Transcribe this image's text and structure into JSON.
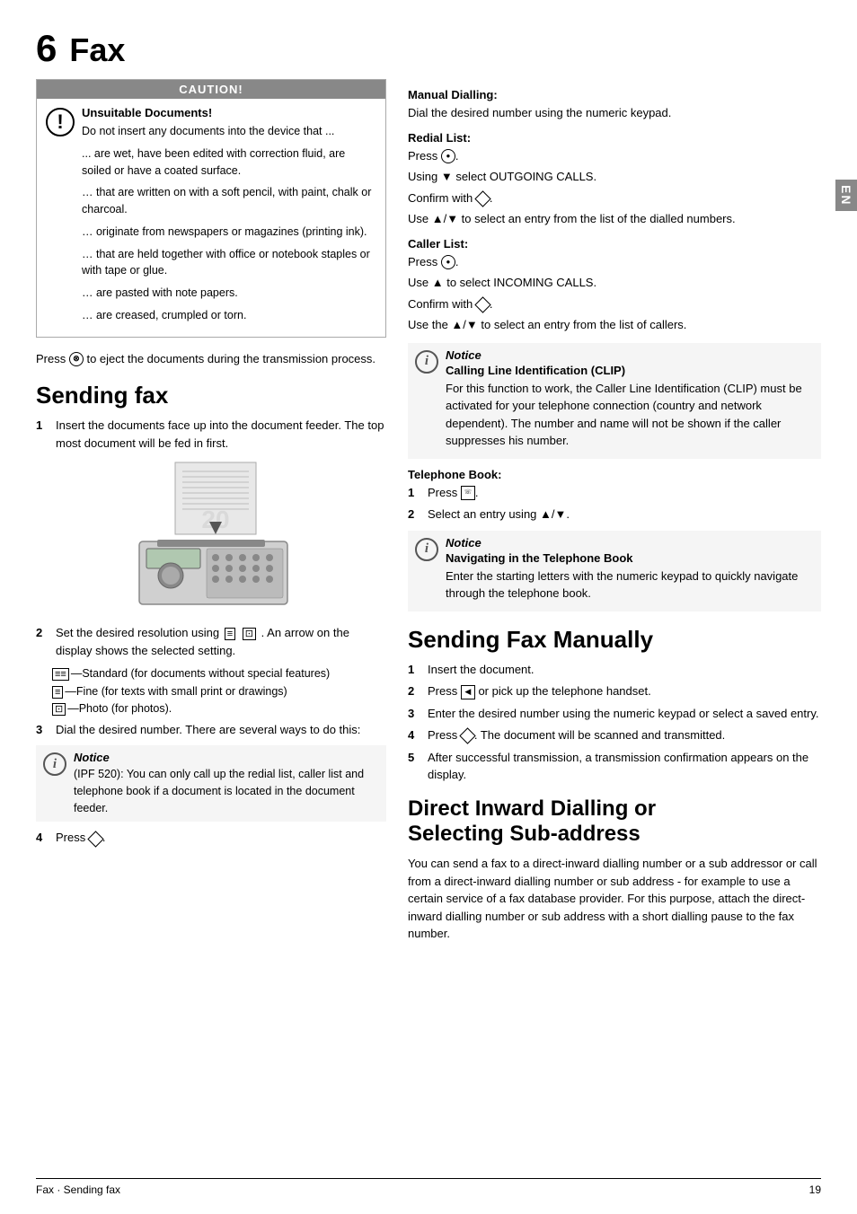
{
  "page": {
    "title_num": "6",
    "title_text": "Fax",
    "footer_left": "Fax · Sending fax",
    "footer_right": "19",
    "en_badge": "EN"
  },
  "caution": {
    "header": "CAUTION!",
    "icon": "!",
    "title": "Unsuitable Documents!",
    "lines": [
      "Do not insert any documents into the device that ...",
      "... are wet, have been edited with correction fluid, are soiled or have a coated surface.",
      "… that are written on with a soft pencil, with paint, chalk or charcoal.",
      "… originate from newspapers or magazines (printing ink).",
      "… that are held together with office or notebook staples or with tape or glue.",
      "… are pasted with note papers.",
      "… are creased, crumpled or torn."
    ]
  },
  "eject_note": "to eject the documents during the transmission process.",
  "sending_fax": {
    "heading": "Sending fax",
    "step1": "Insert the documents face up into the document feeder. The top most document will be fed in first.",
    "step2_intro": "Set the desired resolution using",
    "step2_suffix": ". An arrow on the display shows the selected setting.",
    "res_items": [
      "—Standard (for documents without special features)",
      "—Fine (for texts with small print or drawings)",
      "—Photo (for photos)."
    ],
    "step3": "Dial the desired number. There are several ways to do this:",
    "note_italic": "Notice",
    "note_ipf": "(IPF 520): You can only call up the redial list, caller list and telephone book if a document is located in the document feeder.",
    "step4": "Press"
  },
  "right_col": {
    "manual_dialling_heading": "Manual Dialling:",
    "manual_dialling_text": "Dial the desired number using the numeric keypad.",
    "redial_heading": "Redial List:",
    "redial_lines": [
      "Press",
      "Using ▼  select OUTGOING CALLS.",
      "Confirm with",
      "Use ▲/▼ to select an entry from the list of the dialled numbers."
    ],
    "caller_heading": "Caller List:",
    "caller_lines": [
      "Press",
      "Use ▲  to select INCOMING CALLS.",
      "Confirm with",
      "Use the ▲/▼ to select an entry from the list of callers."
    ],
    "notice_italic": "Notice",
    "clip_title": "Calling Line Identification (CLIP)",
    "clip_text": "For this function to work, the Caller Line Identification (CLIP) must be activated for your telephone connection (country and network dependent). The number and name will not be shown if the caller suppresses his number.",
    "telephone_heading": "Telephone Book:",
    "tel_step1": "Press",
    "tel_step2": "Select an entry using ▲/▼.",
    "nav_notice_italic": "Notice",
    "nav_title": "Navigating in the Telephone Book",
    "nav_text": "Enter the starting letters with the numeric keypad to quickly navigate through the telephone book."
  },
  "sending_manually": {
    "heading": "Sending Fax Manually",
    "steps": [
      "Insert the document.",
      "Press  or pick up the telephone handset.",
      "Enter the desired number using the numeric keypad or select a saved entry.",
      "Press  . The document will be scanned and transmitted.",
      "After successful transmission, a transmission confirmation appears on the display."
    ]
  },
  "direct_dialling": {
    "heading1": "Direct Inward Dialling or",
    "heading2": "Selecting Sub-address",
    "text": "You can send a fax to a direct-inward dialling number or a sub addressor or call from a direct-inward dialling number or sub address - for example to use a certain service of a fax database provider. For this purpose, attach the direct-inward dialling number or sub address with a short dialling pause to the fax number."
  }
}
